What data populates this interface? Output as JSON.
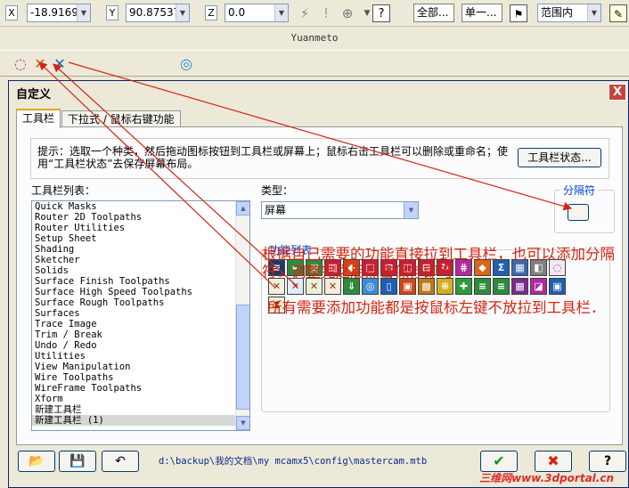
{
  "toolbar": {
    "x_label": "X",
    "x_value": "-18.9169",
    "y_label": "Y",
    "y_value": "90.87537",
    "z_label": "Z",
    "z_value": "0.0",
    "all_button": "全部...",
    "single_button": "单一...",
    "range_select": "范围内"
  },
  "app_title": "Yuanmeto",
  "dialog": {
    "title": "自定义",
    "close": "X",
    "tabs": [
      "工具栏",
      "下拉式 / 鼠标右键功能"
    ],
    "hint": "提示：选取一个种类，然后拖动图标按钮到工具栏或屏幕上；鼠标右击工具栏可以删除或重命名；使用“工具栏状态”去保存屏幕布局。",
    "toolbar_state_button": "工具栏状态...",
    "list_label": "工具栏列表：",
    "toolbar_list": [
      "Quick Masks",
      "Router 2D Toolpaths",
      "Router Utilities",
      "Setup Sheet",
      "Shading",
      "Sketcher",
      "Solids",
      "Surface Finish Toolpaths",
      "Surface High Speed Toolpaths",
      "Surface Rough Toolpaths",
      "Surfaces",
      "Trace Image",
      "Trim / Break",
      "Undo / Redo",
      "Utilities",
      "View Manipulation",
      "Wire Toolpaths",
      "WireFrame Toolpaths",
      "Xform",
      "新建工具栏",
      "新建工具栏 (1)"
    ],
    "selected_index": 20,
    "type_label": "类型：",
    "type_value": "屏幕",
    "separator_label": "分隔符",
    "function_list_label": "功能列表",
    "function_icons": [
      {
        "glyph": "≋",
        "bg": "#1d3a6e"
      },
      {
        "glyph": "▸",
        "bg": "#2e8b3c"
      },
      {
        "glyph": "▤",
        "bg": "#2e8b3c"
      },
      {
        "glyph": "▥",
        "bg": "#c2203a"
      },
      {
        "glyph": "◆",
        "bg": "#d0481a"
      },
      {
        "glyph": "□",
        "bg": "#c2203a"
      },
      {
        "glyph": "⊟",
        "bg": "#c2203a"
      },
      {
        "glyph": "◫",
        "bg": "#c2203a"
      },
      {
        "glyph": "⊞",
        "bg": "#c2203a"
      },
      {
        "glyph": "↻",
        "bg": "#c2203a"
      },
      {
        "glyph": "⋕",
        "bg": "#b02aa0"
      },
      {
        "glyph": "◆",
        "bg": "#d86818"
      },
      {
        "glyph": "Σ",
        "bg": "#1f5fb4"
      },
      {
        "glyph": "▦",
        "bg": "#3a6ab0"
      },
      {
        "glyph": "◧",
        "bg": "#808080"
      },
      {
        "glyph": "◌",
        "bg": "#f0e8f8"
      },
      {
        "glyph": "✕",
        "bg": "#f2efe0"
      },
      {
        "glyph": "✕",
        "bg": "#e0ecf8"
      },
      {
        "glyph": "✕",
        "bg": "#e8f2d8"
      },
      {
        "glyph": "✕",
        "bg": "#f8ecd8"
      },
      {
        "glyph": "⇓",
        "bg": "#2e8b3c"
      },
      {
        "glyph": "◎",
        "bg": "#3c8cd8"
      },
      {
        "glyph": "▯",
        "bg": "#1f5fb4"
      },
      {
        "glyph": "▣",
        "bg": "#d0481a"
      },
      {
        "glyph": "▩",
        "bg": "#c07818"
      },
      {
        "glyph": "⁜",
        "bg": "#d0b020"
      },
      {
        "glyph": "✚",
        "bg": "#2e9b3c"
      },
      {
        "glyph": "≡",
        "bg": "#2e8b3c"
      },
      {
        "glyph": "≡",
        "bg": "#2e8b3c"
      },
      {
        "glyph": "▦",
        "bg": "#7a2a90"
      },
      {
        "glyph": "◪",
        "bg": "#b02aa0"
      },
      {
        "glyph": "▣",
        "bg": "#1f5fb4"
      },
      {
        "glyph": "⧗",
        "bg": "#f4ecd0"
      }
    ],
    "note_line1": "根据自己需要的功能直接拉到工具栏，也可以添加分隔符．调整完之后点击保存即可",
    "note_line2": "所有需要添加功能都是按鼠标左键不放拉到工具栏．",
    "file_path": "d:\\backup\\我的文档\\my mcamx5\\config\\mastercam.mtb",
    "watermark": "三维网www.3dportal.cn"
  },
  "colors": {
    "annotation": "#d42410",
    "arrow": "#d42410",
    "group_label": "#0046d5"
  }
}
